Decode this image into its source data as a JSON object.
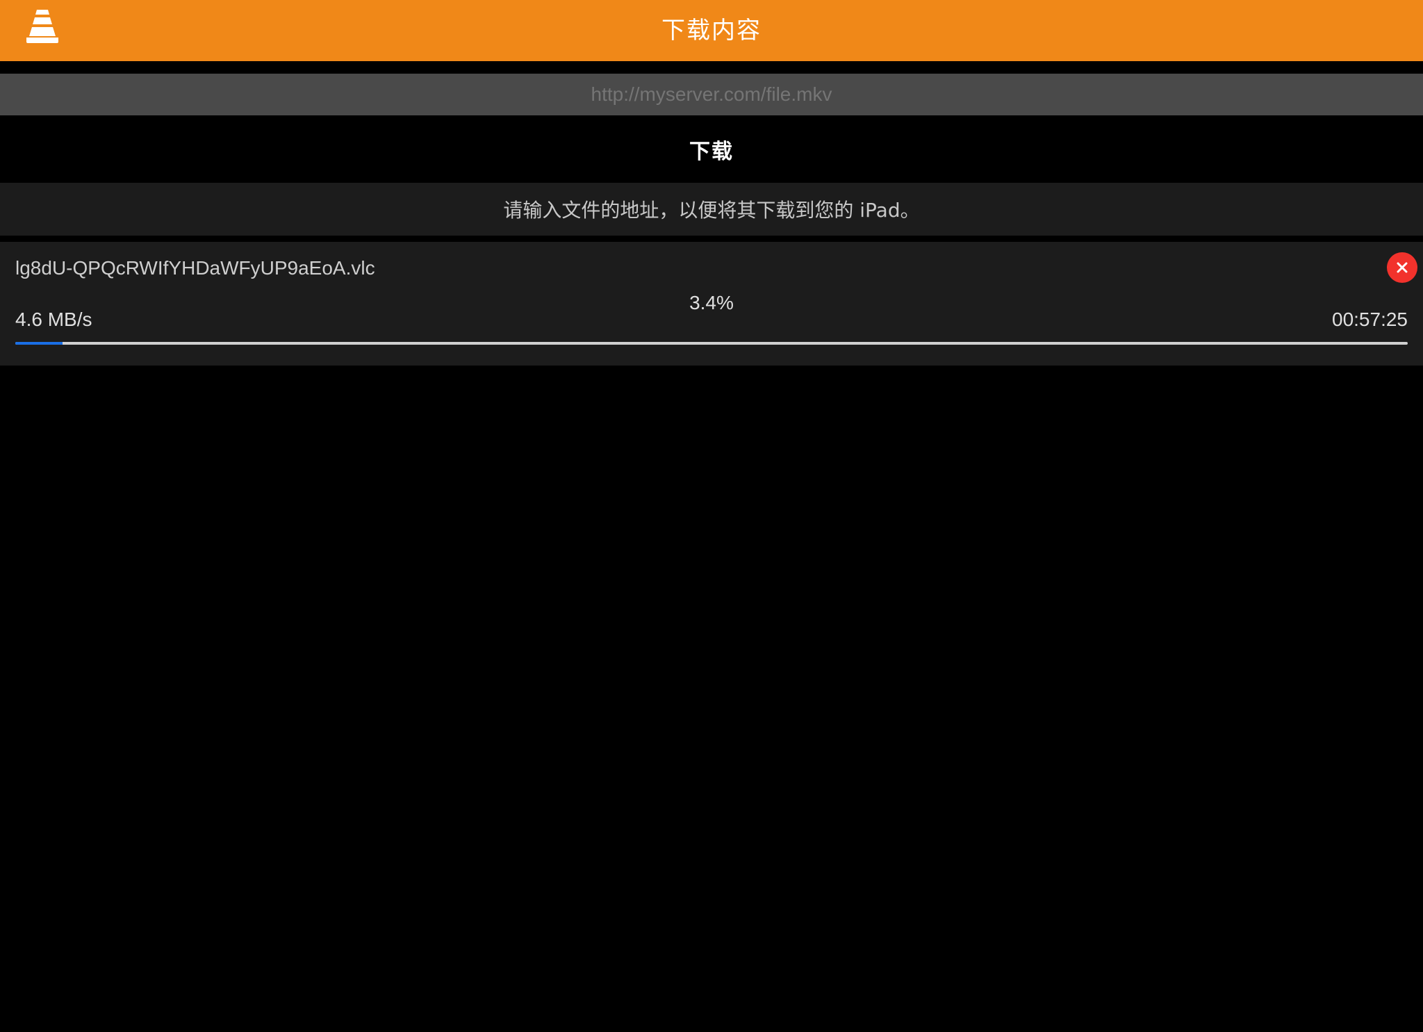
{
  "header": {
    "title": "下载内容",
    "logo_icon": "vlc-cone-icon",
    "background_color": "#f08818"
  },
  "url_input": {
    "placeholder": "http://myserver.com/file.mkv",
    "value": ""
  },
  "download_button": {
    "label": "下载"
  },
  "hint": {
    "text": "请输入文件的地址，以便将其下载到您的 iPad。"
  },
  "downloads": [
    {
      "file_name": "lg8dU-QPQcRWIfYHDaWFyUP9aEoA.vlc",
      "percent_label": "3.4%",
      "progress_fraction": 0.034,
      "speed": "4.6 MB/s",
      "remaining_time": "00:57:25",
      "cancel_icon": "close-icon",
      "progress_color": "#1a6fe6",
      "cancel_color": "#f2322c"
    }
  ]
}
